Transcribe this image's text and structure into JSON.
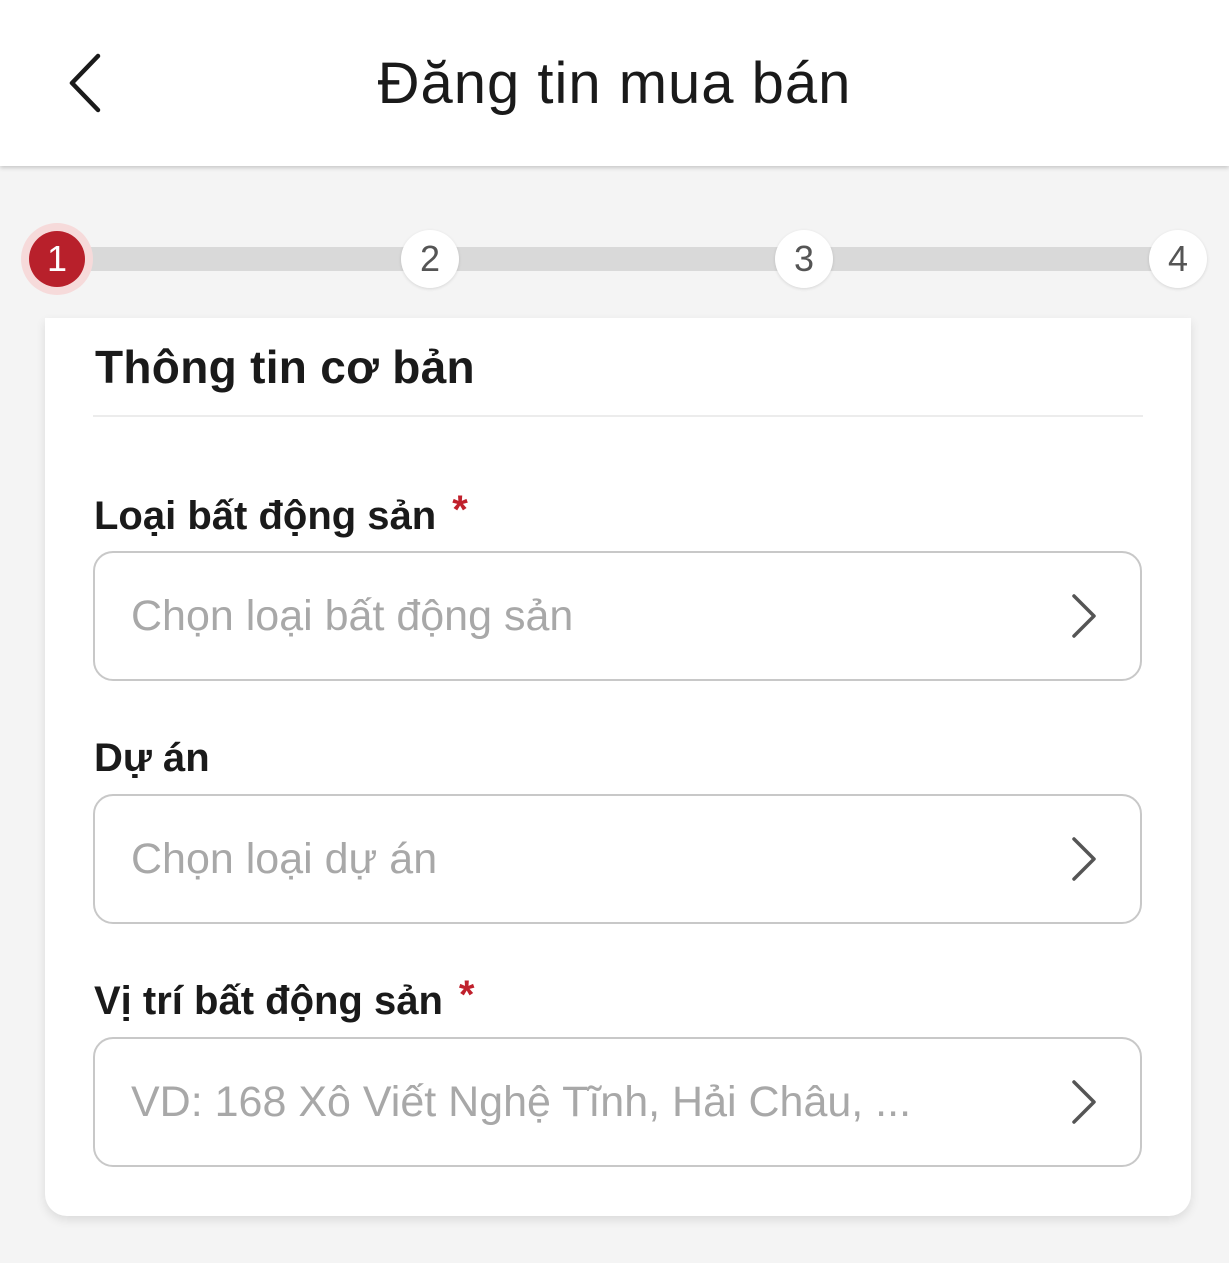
{
  "header": {
    "title": "Đăng tin mua bán",
    "back_icon": "chevron-left-icon"
  },
  "stepper": {
    "current_step": 1,
    "steps": [
      "1",
      "2",
      "3",
      "4"
    ],
    "active_color": "#b8202b"
  },
  "form": {
    "section_title": "Thông tin cơ bản",
    "fields": [
      {
        "label": "Loại bất động sản",
        "required_mark": "*",
        "placeholder": "Chọn loại bất động sản",
        "icon": "chevron-right-icon"
      },
      {
        "label": "Dự án",
        "placeholder": "Chọn loại dự án",
        "icon": "chevron-right-icon"
      },
      {
        "label": "Vị trí bất động sản",
        "required_mark": "*",
        "placeholder": "VD: 168 Xô Viết Nghệ Tĩnh, Hải Châu, ...",
        "icon": "chevron-right-icon"
      }
    ]
  },
  "colors": {
    "required": "#c0202c",
    "background": "#f4f4f4"
  }
}
